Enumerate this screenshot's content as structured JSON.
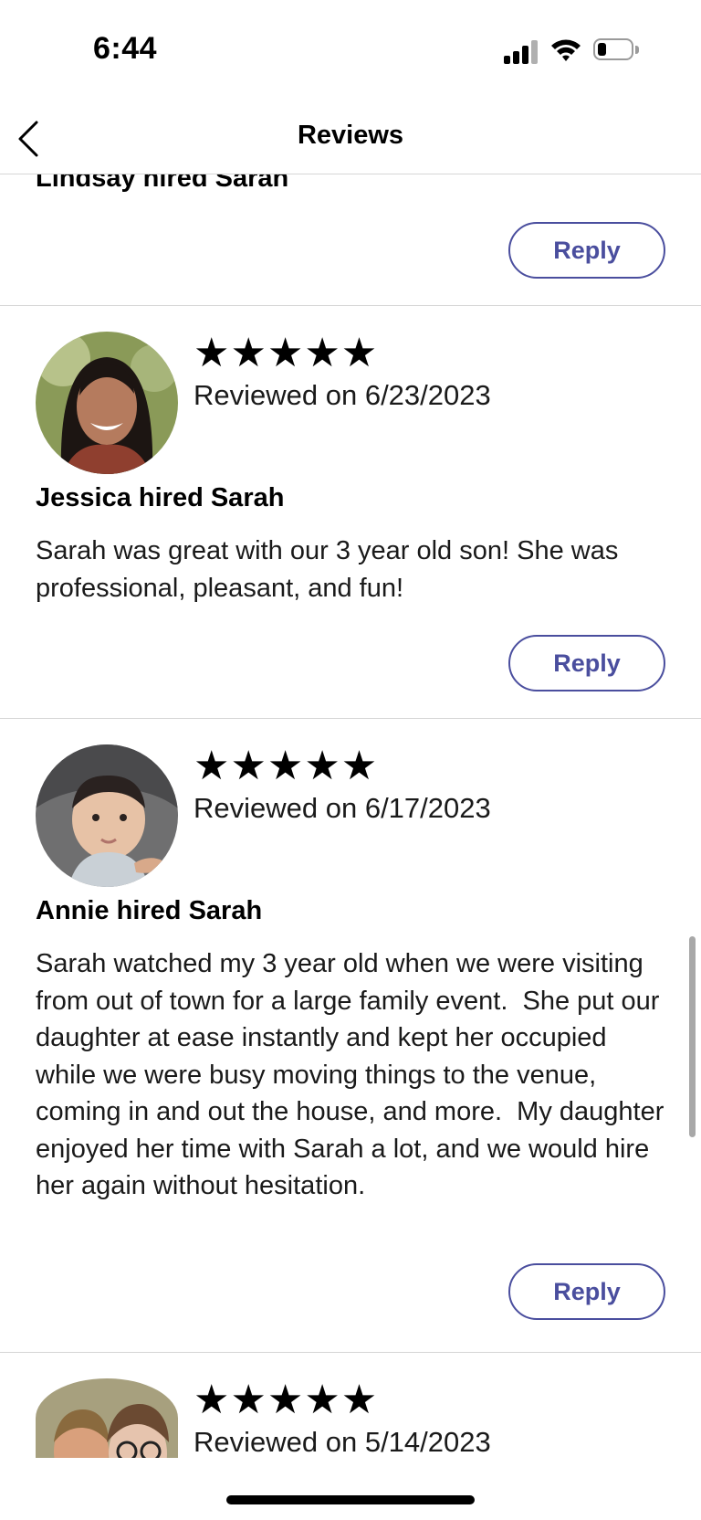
{
  "status_bar": {
    "time": "6:44"
  },
  "nav": {
    "title": "Reviews",
    "back_icon": "chevron-left-icon"
  },
  "reviews": [
    {
      "reviewer": "Lindsay",
      "hired_line": "Lindsay hired Sarah",
      "reply_label": "Reply"
    },
    {
      "reviewer": "Jessica",
      "stars": "★★★★★",
      "rating": 5,
      "reviewed_on": "Reviewed on 6/23/2023",
      "hired_line": "Jessica hired Sarah",
      "text": "Sarah was great with our 3 year old son! She was professional, pleasant, and fun!",
      "reply_label": "Reply"
    },
    {
      "reviewer": "Annie",
      "stars": "★★★★★",
      "rating": 5,
      "reviewed_on": "Reviewed on 6/17/2023",
      "hired_line": "Annie hired Sarah",
      "text": "Sarah watched my 3 year old when we were visiting from out of town for a large family event.  She put our daughter at ease instantly and kept her occupied while we were busy moving things to the venue, coming in and out the house, and more.  My daughter enjoyed her time with Sarah a lot, and we would hire her again without hesitation.",
      "reply_label": "Reply"
    },
    {
      "stars": "★★★★★",
      "rating": 5,
      "reviewed_on": "Reviewed on 5/14/2023"
    }
  ],
  "colors": {
    "accent": "#4a4e9e",
    "divider": "#d6d6d6",
    "text": "#000000"
  }
}
